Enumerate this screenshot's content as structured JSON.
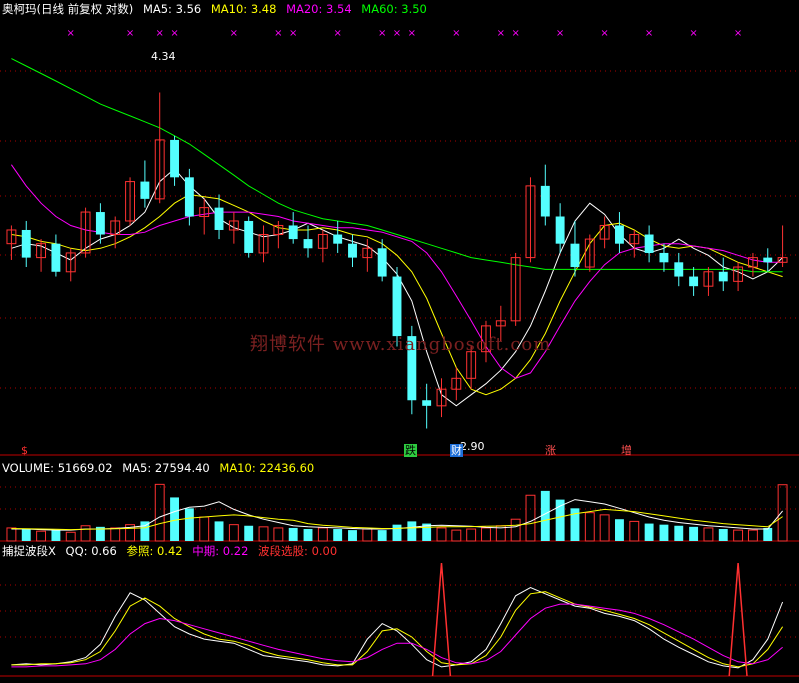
{
  "main_header": {
    "title": "奥柯玛(日线 前复权 对数)",
    "ma5_label": "MA5:",
    "ma5_value": "3.56",
    "ma10_label": "MA10:",
    "ma10_value": "3.48",
    "ma20_label": "MA20:",
    "ma20_value": "3.54",
    "ma60_label": "MA60:",
    "ma60_value": "3.50"
  },
  "volume_header": {
    "label": "VOLUME:",
    "value": "51669.02",
    "ma5_label": "MA5:",
    "ma5_value": "27594.40",
    "ma10_label": "MA10:",
    "ma10_value": "22436.60"
  },
  "indicator_header": {
    "name": "捕捉波段X",
    "qq_label": "QQ:",
    "qq_value": "0.66",
    "ref_label": "参照:",
    "ref_value": "0.42",
    "mid_label": "中期:",
    "mid_value": "0.22",
    "pick_label": "波段选股:",
    "pick_value": "0.00"
  },
  "watermark": "翔博软件 www.xiangbosoft.com",
  "annotations": {
    "high_price": "4.34",
    "low_price": "2.90",
    "marker_dollar": "$",
    "marker_fall": "跌",
    "marker_wealth": "财",
    "marker_rise": "涨",
    "marker_increase": "增",
    "cross_marker": "×"
  },
  "colors": {
    "background": "#000000",
    "up_candle": "#ff3232",
    "down_candle": "#54ffff",
    "ma5": "#ffffff",
    "ma10": "#ffff00",
    "ma20": "#ff00ff",
    "ma60": "#00ff00",
    "grid": "#aa0000",
    "axis": "#c00000",
    "cross_marker_color": "#ff00ff"
  },
  "chart_data": [
    {
      "type": "candlestick",
      "scale": "log",
      "title": "奥柯玛(日线 前复权 对数)",
      "ylim": [
        2.85,
        4.6
      ],
      "series": [
        {
          "name": "MA5",
          "values": [
            3.6,
            3.62,
            3.61,
            3.58,
            3.55,
            3.6,
            3.64,
            3.66,
            3.7,
            3.76,
            3.9,
            3.96,
            3.88,
            3.82,
            3.73,
            3.69,
            3.67,
            3.65,
            3.66,
            3.68,
            3.71,
            3.68,
            3.65,
            3.63,
            3.61,
            3.56,
            3.49,
            3.38,
            3.18,
            3.02,
            2.98,
            3.02,
            3.06,
            3.11,
            3.18,
            3.28,
            3.42,
            3.58,
            3.72,
            3.8,
            3.75,
            3.66,
            3.6,
            3.58,
            3.6,
            3.64,
            3.6,
            3.57,
            3.52,
            3.5,
            3.47,
            3.5,
            3.56
          ]
        },
        {
          "name": "MA10",
          "values": [
            3.66,
            3.65,
            3.63,
            3.62,
            3.6,
            3.59,
            3.6,
            3.62,
            3.65,
            3.69,
            3.74,
            3.8,
            3.84,
            3.83,
            3.82,
            3.79,
            3.76,
            3.72,
            3.69,
            3.68,
            3.68,
            3.69,
            3.68,
            3.66,
            3.65,
            3.62,
            3.57,
            3.5,
            3.39,
            3.25,
            3.12,
            3.04,
            3.02,
            3.04,
            3.08,
            3.15,
            3.25,
            3.38,
            3.5,
            3.62,
            3.7,
            3.71,
            3.68,
            3.64,
            3.61,
            3.6,
            3.61,
            3.6,
            3.57,
            3.54,
            3.52,
            3.5,
            3.48
          ]
        },
        {
          "name": "MA20",
          "values": [
            3.98,
            3.88,
            3.8,
            3.74,
            3.7,
            3.68,
            3.67,
            3.66,
            3.66,
            3.67,
            3.7,
            3.72,
            3.74,
            3.75,
            3.76,
            3.76,
            3.76,
            3.75,
            3.74,
            3.72,
            3.71,
            3.7,
            3.69,
            3.69,
            3.68,
            3.67,
            3.65,
            3.63,
            3.58,
            3.5,
            3.4,
            3.3,
            3.2,
            3.12,
            3.08,
            3.1,
            3.18,
            3.28,
            3.38,
            3.46,
            3.53,
            3.58,
            3.6,
            3.61,
            3.62,
            3.62,
            3.61,
            3.6,
            3.59,
            3.57,
            3.55,
            3.54,
            3.54
          ]
        },
        {
          "name": "MA60",
          "values": [
            4.52,
            4.48,
            4.44,
            4.4,
            4.36,
            4.32,
            4.28,
            4.25,
            4.22,
            4.19,
            4.16,
            4.12,
            4.08,
            4.03,
            3.98,
            3.93,
            3.88,
            3.84,
            3.8,
            3.77,
            3.75,
            3.73,
            3.72,
            3.71,
            3.7,
            3.68,
            3.66,
            3.64,
            3.62,
            3.6,
            3.58,
            3.56,
            3.55,
            3.54,
            3.53,
            3.52,
            3.51,
            3.51,
            3.51,
            3.51,
            3.51,
            3.51,
            3.51,
            3.51,
            3.51,
            3.51,
            3.51,
            3.51,
            3.51,
            3.51,
            3.5,
            3.5,
            3.5
          ]
        }
      ],
      "candles": [
        [
          3.62,
          3.7,
          3.55,
          3.68
        ],
        [
          3.68,
          3.72,
          3.52,
          3.56
        ],
        [
          3.56,
          3.64,
          3.5,
          3.62
        ],
        [
          3.62,
          3.66,
          3.48,
          3.5
        ],
        [
          3.5,
          3.6,
          3.46,
          3.58
        ],
        [
          3.58,
          3.78,
          3.56,
          3.76
        ],
        [
          3.76,
          3.8,
          3.62,
          3.66
        ],
        [
          3.66,
          3.74,
          3.6,
          3.72
        ],
        [
          3.72,
          3.92,
          3.7,
          3.9
        ],
        [
          3.9,
          4.0,
          3.78,
          3.82
        ],
        [
          3.82,
          4.34,
          3.8,
          4.1
        ],
        [
          4.1,
          4.12,
          3.88,
          3.92
        ],
        [
          3.92,
          3.96,
          3.7,
          3.74
        ],
        [
          3.74,
          3.82,
          3.66,
          3.78
        ],
        [
          3.78,
          3.84,
          3.64,
          3.68
        ],
        [
          3.68,
          3.76,
          3.62,
          3.72
        ],
        [
          3.72,
          3.74,
          3.56,
          3.58
        ],
        [
          3.58,
          3.7,
          3.54,
          3.66
        ],
        [
          3.66,
          3.72,
          3.6,
          3.7
        ],
        [
          3.7,
          3.76,
          3.62,
          3.64
        ],
        [
          3.64,
          3.7,
          3.56,
          3.6
        ],
        [
          3.6,
          3.68,
          3.54,
          3.66
        ],
        [
          3.66,
          3.72,
          3.58,
          3.62
        ],
        [
          3.62,
          3.66,
          3.52,
          3.56
        ],
        [
          3.56,
          3.64,
          3.5,
          3.6
        ],
        [
          3.6,
          3.64,
          3.46,
          3.48
        ],
        [
          3.48,
          3.52,
          3.2,
          3.24
        ],
        [
          3.24,
          3.28,
          2.95,
          3.0
        ],
        [
          3.0,
          3.06,
          2.9,
          2.98
        ],
        [
          2.98,
          3.08,
          2.94,
          3.04
        ],
        [
          3.04,
          3.12,
          3.0,
          3.08
        ],
        [
          3.08,
          3.2,
          3.04,
          3.18
        ],
        [
          3.18,
          3.3,
          3.14,
          3.28
        ],
        [
          3.28,
          3.36,
          3.22,
          3.3
        ],
        [
          3.3,
          3.58,
          3.28,
          3.56
        ],
        [
          3.56,
          3.92,
          3.54,
          3.88
        ],
        [
          3.88,
          3.98,
          3.7,
          3.74
        ],
        [
          3.74,
          3.8,
          3.58,
          3.62
        ],
        [
          3.62,
          3.72,
          3.48,
          3.52
        ],
        [
          3.52,
          3.66,
          3.5,
          3.64
        ],
        [
          3.64,
          3.74,
          3.6,
          3.7
        ],
        [
          3.7,
          3.76,
          3.58,
          3.62
        ],
        [
          3.62,
          3.68,
          3.56,
          3.66
        ],
        [
          3.66,
          3.7,
          3.54,
          3.58
        ],
        [
          3.58,
          3.62,
          3.5,
          3.54
        ],
        [
          3.54,
          3.58,
          3.44,
          3.48
        ],
        [
          3.48,
          3.52,
          3.4,
          3.44
        ],
        [
          3.44,
          3.52,
          3.4,
          3.5
        ],
        [
          3.5,
          3.56,
          3.42,
          3.46
        ],
        [
          3.46,
          3.54,
          3.42,
          3.52
        ],
        [
          3.52,
          3.58,
          3.48,
          3.56
        ],
        [
          3.56,
          3.6,
          3.5,
          3.54
        ],
        [
          3.54,
          3.7,
          3.52,
          3.56
        ]
      ]
    },
    {
      "type": "bar",
      "title": "VOLUME",
      "series": [
        {
          "name": "VOLUME",
          "values": [
            12000,
            11000,
            9000,
            10000,
            8000,
            14000,
            13000,
            12000,
            15000,
            18000,
            52000,
            40000,
            30000,
            22000,
            18000,
            15000,
            14000,
            13000,
            12000,
            12000,
            11000,
            12000,
            11000,
            10000,
            11000,
            10000,
            15000,
            18000,
            16000,
            12000,
            10000,
            11000,
            12000,
            14000,
            20000,
            42000,
            46000,
            38000,
            30000,
            26000,
            24000,
            20000,
            18000,
            16000,
            15000,
            14000,
            13000,
            12000,
            11000,
            10000,
            10000,
            12000,
            51669.02
          ]
        },
        {
          "name": "MA5",
          "values": [
            11000,
            11000,
            10500,
            10000,
            10000,
            11000,
            11000,
            11500,
            12500,
            14000,
            22000,
            27000,
            31000,
            32000,
            36000,
            29000,
            24000,
            20000,
            17000,
            14000,
            13000,
            12500,
            12000,
            11500,
            11000,
            11000,
            11500,
            12500,
            14000,
            14500,
            14000,
            13500,
            12500,
            12000,
            13000,
            18000,
            25000,
            32000,
            38000,
            36000,
            34000,
            30000,
            26000,
            22000,
            19000,
            17000,
            15500,
            14000,
            13000,
            12000,
            11000,
            11000,
            27594.4
          ]
        },
        {
          "name": "MA10",
          "values": [
            11500,
            11200,
            11000,
            10800,
            10500,
            10800,
            11000,
            11200,
            11600,
            12200,
            16000,
            19000,
            21000,
            22000,
            23000,
            24000,
            23000,
            21500,
            20000,
            19000,
            16000,
            14500,
            13500,
            12500,
            12000,
            11500,
            11600,
            12000,
            12500,
            13000,
            13000,
            13200,
            13500,
            13800,
            14500,
            16000,
            19000,
            22000,
            25000,
            27000,
            29000,
            28000,
            27000,
            25000,
            23000,
            21000,
            19000,
            17500,
            16000,
            15000,
            14000,
            13000,
            22436.6
          ]
        }
      ]
    },
    {
      "type": "line",
      "title": "捕捉波段X",
      "ylim": [
        0,
        1
      ],
      "series": [
        {
          "name": "QQ",
          "values": [
            0.05,
            0.06,
            0.05,
            0.06,
            0.08,
            0.12,
            0.25,
            0.52,
            0.75,
            0.68,
            0.55,
            0.42,
            0.35,
            0.3,
            0.28,
            0.26,
            0.2,
            0.14,
            0.12,
            0.1,
            0.08,
            0.05,
            0.04,
            0.06,
            0.3,
            0.45,
            0.38,
            0.25,
            0.1,
            0.03,
            0.05,
            0.08,
            0.2,
            0.45,
            0.72,
            0.8,
            0.74,
            0.68,
            0.62,
            0.6,
            0.55,
            0.52,
            0.48,
            0.4,
            0.3,
            0.22,
            0.15,
            0.08,
            0.04,
            0.02,
            0.1,
            0.3,
            0.66
          ]
        },
        {
          "name": "参照",
          "values": [
            0.05,
            0.05,
            0.06,
            0.06,
            0.07,
            0.1,
            0.18,
            0.38,
            0.62,
            0.7,
            0.62,
            0.5,
            0.42,
            0.35,
            0.3,
            0.28,
            0.24,
            0.18,
            0.14,
            0.12,
            0.1,
            0.07,
            0.05,
            0.05,
            0.18,
            0.38,
            0.4,
            0.32,
            0.18,
            0.07,
            0.05,
            0.06,
            0.14,
            0.32,
            0.58,
            0.74,
            0.76,
            0.7,
            0.64,
            0.61,
            0.58,
            0.54,
            0.5,
            0.44,
            0.36,
            0.28,
            0.2,
            0.12,
            0.06,
            0.03,
            0.06,
            0.2,
            0.42
          ]
        },
        {
          "name": "中期",
          "values": [
            0.03,
            0.03,
            0.04,
            0.04,
            0.05,
            0.06,
            0.1,
            0.2,
            0.35,
            0.45,
            0.5,
            0.48,
            0.44,
            0.4,
            0.36,
            0.32,
            0.28,
            0.24,
            0.2,
            0.17,
            0.14,
            0.11,
            0.09,
            0.08,
            0.12,
            0.2,
            0.26,
            0.26,
            0.2,
            0.12,
            0.07,
            0.06,
            0.09,
            0.18,
            0.34,
            0.5,
            0.6,
            0.64,
            0.64,
            0.62,
            0.6,
            0.58,
            0.55,
            0.5,
            0.44,
            0.37,
            0.3,
            0.22,
            0.14,
            0.08,
            0.06,
            0.1,
            0.22
          ]
        },
        {
          "name": "波段选股",
          "values": [
            0,
            0,
            0,
            0,
            0,
            0,
            0,
            0,
            0,
            0,
            0,
            0,
            0,
            0,
            0,
            0,
            0,
            0,
            0,
            0,
            0,
            0,
            0,
            0,
            0,
            0,
            0,
            0,
            0,
            1,
            0,
            0,
            0,
            0,
            0,
            0,
            0,
            0,
            0,
            0,
            0,
            0,
            0,
            0,
            0,
            0,
            0,
            0,
            0,
            1,
            0,
            0,
            0
          ]
        }
      ]
    }
  ]
}
